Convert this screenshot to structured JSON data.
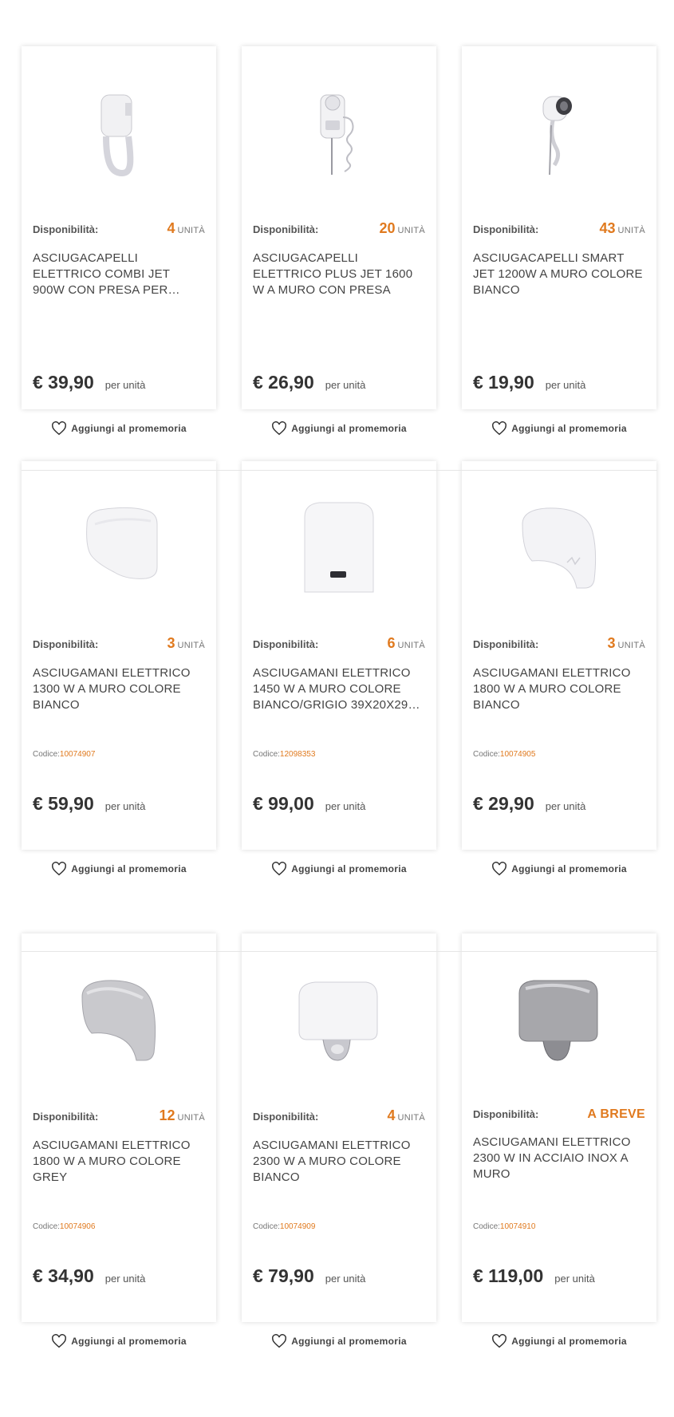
{
  "common": {
    "avail_label": "Disponibilità:",
    "unit_label": "UNITÀ",
    "per_unit": "per unità",
    "remind_label": "Aggiungi al promemoria",
    "code_label": "Codice:"
  },
  "products": [
    {
      "avail": "4",
      "title": "ASCIUGACAPELLI ELETTRICO COMBI JET 900W CON PRESA PER…",
      "price": "€ 39,90",
      "code": "",
      "icon": "hair-dryer-combi-icon"
    },
    {
      "avail": "20",
      "title": "ASCIUGACAPELLI ELETTRICO PLUS JET 1600 W A MURO CON PRESA PER…",
      "price": "€ 26,90",
      "code": "",
      "icon": "hair-dryer-plus-icon"
    },
    {
      "avail": "43",
      "title": "ASCIUGACAPELLI SMART JET 1200W A MURO COLORE BIANCO",
      "price": "€ 19,90",
      "code": "",
      "icon": "hair-dryer-smart-icon"
    },
    {
      "avail": "3",
      "title": "ASCIUGAMANI ELETTRICO 1300 W A MURO COLORE BIANCO",
      "price": "€ 59,90",
      "code": "10074907",
      "icon": "hand-dryer-white-icon"
    },
    {
      "avail": "6",
      "title": "ASCIUGAMANI ELETTRICO 1450 W A MURO COLORE BIANCO/GRIGIO 39X20X29…",
      "price": "€ 99,00",
      "code": "12098353",
      "icon": "hand-dryer-box-icon"
    },
    {
      "avail": "3",
      "title": "ASCIUGAMANI ELETTRICO 1800 W A MURO COLORE BIANCO",
      "price": "€ 29,90",
      "code": "10074905",
      "icon": "hand-dryer-dome-white-icon"
    },
    {
      "avail": "12",
      "title": "ASCIUGAMANI ELETTRICO 1800 W A MURO COLORE GREY",
      "price": "€ 34,90",
      "code": "10074906",
      "icon": "hand-dryer-dome-grey-icon"
    },
    {
      "avail": "4",
      "title": "ASCIUGAMANI ELETTRICO 2300 W A MURO COLORE BIANCO",
      "price": "€ 79,90",
      "code": "10074909",
      "icon": "hand-dryer-nozzle-white-icon"
    },
    {
      "avail": "A BREVE",
      "title": "ASCIUGAMANI ELETTRICO 2300 W IN ACCIAIO INOX A MURO",
      "price": "€ 119,00",
      "code": "10074910",
      "icon": "hand-dryer-nozzle-steel-icon"
    }
  ],
  "colors": {
    "accent": "#e07a1f",
    "text": "#333333"
  }
}
